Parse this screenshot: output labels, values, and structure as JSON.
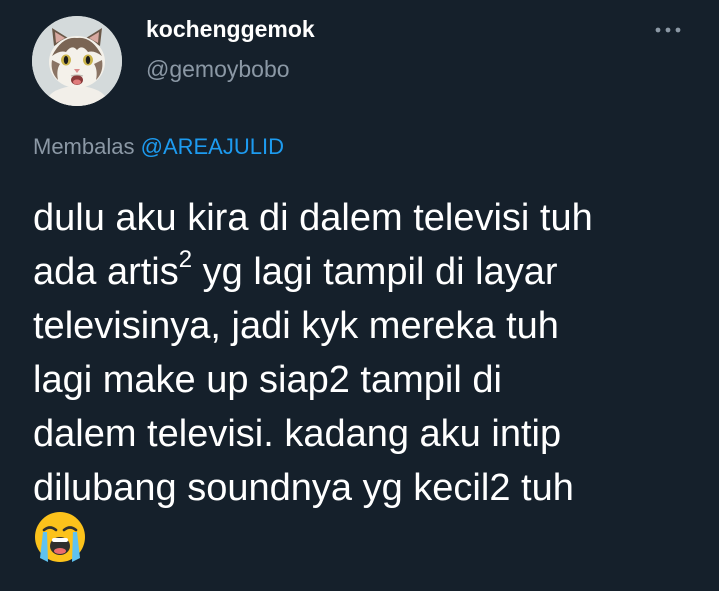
{
  "author": {
    "display_name": "kochenggemok",
    "handle": "@gemoybobo",
    "avatar_icon": "cat-avatar-icon"
  },
  "reply": {
    "prefix": "Membalas",
    "mention": "@AREAJULID"
  },
  "tweet": {
    "line1": "dulu aku kira di dalem televisi tuh",
    "line2_a": "ada artis",
    "line2_sup": "2",
    "line2_b": " yg lagi tampil di layar",
    "line3": "televisinya, jadi kyk mereka tuh",
    "line4": "lagi make up siap2 tampil di",
    "line5": "dalem televisi. kadang aku intip",
    "line6": "dilubang soundnya yg kecil2 tuh",
    "emoji": "loudly-crying-face-icon"
  },
  "colors": {
    "background": "#15202b",
    "text_primary": "#ffffff",
    "text_secondary": "#8b98a5",
    "accent": "#1d9bf0"
  }
}
